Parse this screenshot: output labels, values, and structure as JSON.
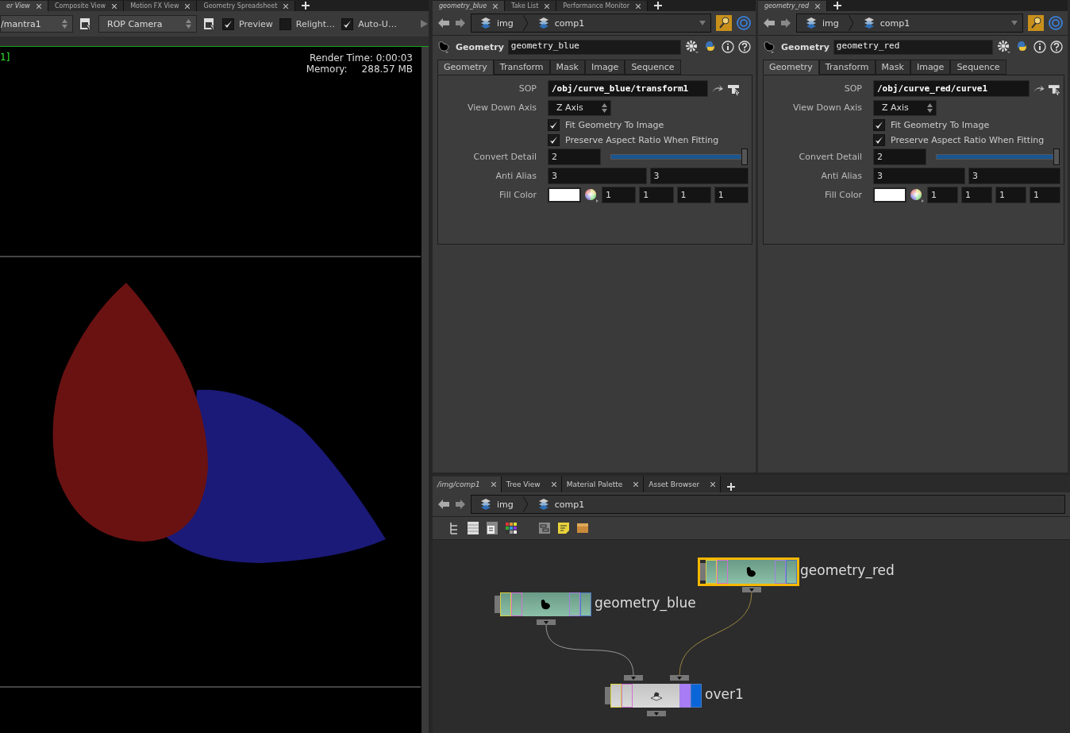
{
  "viewer": {
    "tabs": [
      {
        "label": "er View",
        "selected": true
      },
      {
        "label": "Composite View",
        "selected": false
      },
      {
        "label": "Motion FX View",
        "selected": false
      },
      {
        "label": "Geometry Spreadsheet",
        "selected": false
      }
    ],
    "rop": "/mantra1",
    "camera": "ROP Camera",
    "options": [
      {
        "label": "Preview",
        "checked": true
      },
      {
        "label": "Relight…",
        "checked": false
      },
      {
        "label": "Auto-U…",
        "checked": true
      }
    ],
    "frame_label": "1]",
    "render_time": "Render Time: 0:00:03",
    "memory_label": "Memory:",
    "memory_value": "288.57 MB"
  },
  "param_panes": [
    {
      "tabs": [
        {
          "label": "geometry_blue",
          "selected": true
        },
        {
          "label": "Take List",
          "selected": false
        },
        {
          "label": "Performance Monitor",
          "selected": false
        }
      ],
      "path": [
        "img",
        "comp1"
      ],
      "node_type": "Geometry",
      "node_name": "geometry_blue",
      "param_tabs": [
        {
          "label": "Geometry",
          "selected": true
        },
        {
          "label": "Transform",
          "selected": false
        },
        {
          "label": "Mask",
          "selected": false
        },
        {
          "label": "Image",
          "selected": false
        },
        {
          "label": "Sequence",
          "selected": false
        }
      ],
      "params": [
        {
          "kind": "path",
          "label": "SOP",
          "value": "/obj/curve_blue/transform1"
        },
        {
          "kind": "menu",
          "label": "View Down Axis",
          "value": "Z Axis"
        },
        {
          "kind": "toggle",
          "label": "Fit Geometry To Image",
          "checked": true
        },
        {
          "kind": "toggle",
          "label": "Preserve Aspect Ratio When Fitting",
          "checked": true
        },
        {
          "kind": "slider",
          "label": "Convert Detail",
          "value": "2",
          "level": 1
        },
        {
          "kind": "vector",
          "label": "Anti Alias",
          "values": [
            "3",
            "3"
          ]
        },
        {
          "kind": "color",
          "label": "Fill Color",
          "values": [
            "1",
            "1",
            "1",
            "1"
          ]
        }
      ]
    },
    {
      "tabs": [
        {
          "label": "geometry_red",
          "selected": true
        }
      ],
      "path": [
        "img",
        "comp1"
      ],
      "node_type": "Geometry",
      "node_name": "geometry_red",
      "param_tabs": [
        {
          "label": "Geometry",
          "selected": true
        },
        {
          "label": "Transform",
          "selected": false
        },
        {
          "label": "Mask",
          "selected": false
        },
        {
          "label": "Image",
          "selected": false
        },
        {
          "label": "Sequence",
          "selected": false
        }
      ],
      "params": [
        {
          "kind": "path",
          "label": "SOP",
          "value": "/obj/curve_red/curve1"
        },
        {
          "kind": "menu",
          "label": "View Down Axis",
          "value": "Z Axis"
        },
        {
          "kind": "toggle",
          "label": "Fit Geometry To Image",
          "checked": true
        },
        {
          "kind": "toggle",
          "label": "Preserve Aspect Ratio When Fitting",
          "checked": true
        },
        {
          "kind": "slider",
          "label": "Convert Detail",
          "value": "2",
          "level": 1
        },
        {
          "kind": "vector",
          "label": "Anti Alias",
          "values": [
            "3",
            "3"
          ]
        },
        {
          "kind": "color",
          "label": "Fill Color",
          "values": [
            "1",
            "1",
            "1",
            "1"
          ]
        }
      ]
    }
  ],
  "network": {
    "tabs": [
      {
        "label": "/img/comp1",
        "selected": true
      },
      {
        "label": "Tree View",
        "selected": false
      },
      {
        "label": "Material Palette",
        "selected": false
      },
      {
        "label": "Asset Browser",
        "selected": false
      }
    ],
    "path": [
      "img",
      "comp1"
    ],
    "nodes": [
      {
        "kind": "geometry",
        "name": "geometry_blue",
        "selected": false,
        "display": false
      },
      {
        "kind": "geometry",
        "name": "geometry_red",
        "selected": true,
        "display": false
      },
      {
        "kind": "over",
        "name": "over1",
        "selected": false,
        "display": true
      }
    ]
  }
}
